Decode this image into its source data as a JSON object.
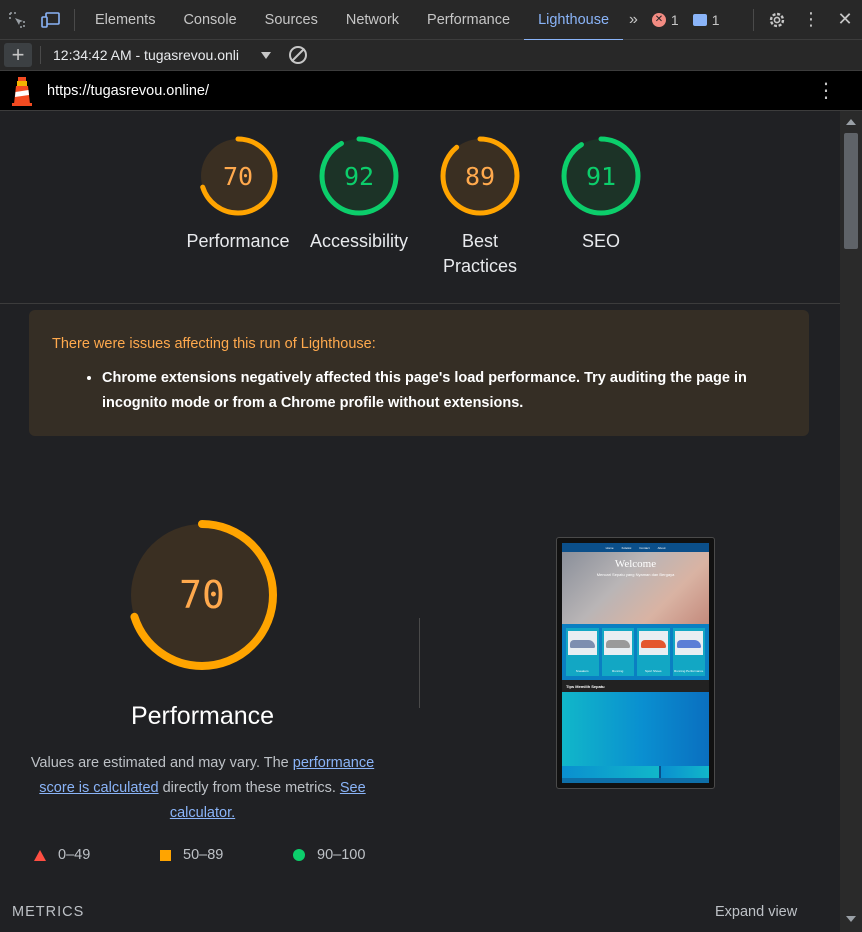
{
  "devtools": {
    "tabs": [
      "Elements",
      "Console",
      "Sources",
      "Network",
      "Performance",
      "Lighthouse"
    ],
    "active_tab": "Lighthouse",
    "error_count": "1",
    "message_count": "1"
  },
  "toolbar": {
    "report_select": "12:34:42 AM - tugasrevou.onli"
  },
  "urlbar": {
    "url": "https://tugasrevou.online/"
  },
  "scores": [
    {
      "label": "Performance",
      "value": "70",
      "score": 70,
      "color": "#ffa400"
    },
    {
      "label": "Accessibility",
      "value": "92",
      "score": 92,
      "color": "#0cce6b"
    },
    {
      "label": "Best Practices",
      "value": "89",
      "score": 89,
      "color": "#ffa400"
    },
    {
      "label": "SEO",
      "value": "91",
      "score": 91,
      "color": "#0cce6b"
    }
  ],
  "warning": {
    "title": "There were issues affecting this run of Lighthouse:",
    "items": [
      "Chrome extensions negatively affected this page's load performance. Try auditing the page in incognito mode or from a Chrome profile without extensions."
    ]
  },
  "performance": {
    "value": "70",
    "score": 70,
    "title": "Performance",
    "note_prefix": "Values are estimated and may vary. The ",
    "note_link1": "performance score is calculated",
    "note_middle": " directly from these metrics. ",
    "note_link2": "See calculator."
  },
  "legend": {
    "fail": "0–49",
    "average": "50–89",
    "pass": "90–100"
  },
  "thumbnail": {
    "nav": [
      "Home",
      "Koleksi",
      "Contact",
      "About"
    ],
    "heading": "Welcome",
    "subheading": "Mencari Sepatu yang Nyaman dan Bergaya",
    "section": "Tips Memilih Sepatu",
    "products": [
      "Sneakers",
      "Running",
      "Sport Shoes",
      "Running Performance"
    ]
  },
  "footer": {
    "metrics_label": "METRICS",
    "expand_label": "Expand view"
  },
  "colors": {
    "fail": "#ff4e42",
    "average": "#ffa400",
    "pass": "#0cce6b",
    "link": "#8ab4f8"
  }
}
